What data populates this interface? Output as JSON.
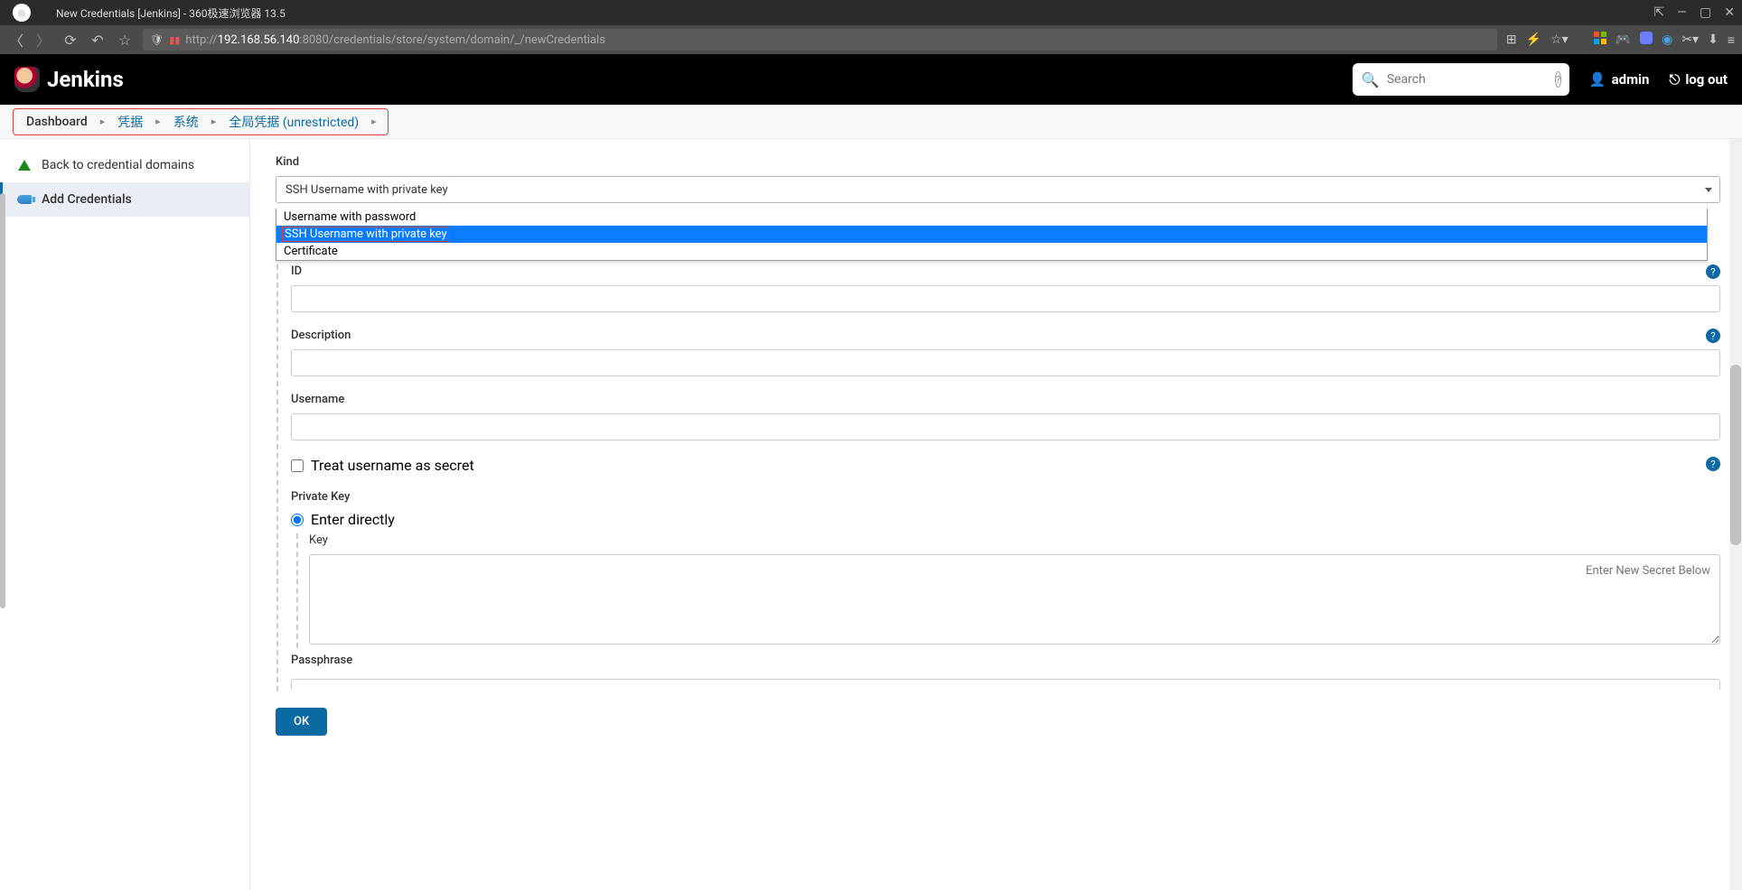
{
  "browser": {
    "title": "New Credentials [Jenkins] - 360极速浏览器 13.5",
    "url_prefix": "http://",
    "url_host": "192.168.56.140",
    "url_port_path": ":8080/credentials/store/system/domain/_/newCredentials"
  },
  "header": {
    "product": "Jenkins",
    "search_placeholder": "Search",
    "user": "admin",
    "logout": "log out"
  },
  "breadcrumb": {
    "items": [
      "Dashboard",
      "凭据",
      "系统",
      "全局凭据 (unrestricted)"
    ]
  },
  "sidebar": {
    "back": "Back to credential domains",
    "add": "Add Credentials"
  },
  "form": {
    "kind_label": "Kind",
    "kind_selected": "SSH Username with private key",
    "kind_options": [
      "Username with password",
      "SSH Username with private key",
      "Certificate"
    ],
    "id_label": "ID",
    "desc_label": "Description",
    "username_label": "Username",
    "treat_secret_label": "Treat username as secret",
    "private_key_label": "Private Key",
    "enter_directly_label": "Enter directly",
    "key_label": "Key",
    "key_placeholder": "Enter New Secret Below",
    "passphrase_label": "Passphrase",
    "ok_label": "OK"
  }
}
